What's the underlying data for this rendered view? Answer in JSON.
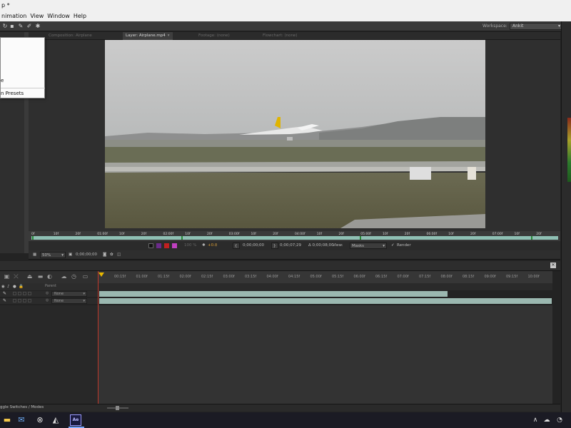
{
  "window": {
    "title_fragment": "p *"
  },
  "menu": [
    "nimation",
    "View",
    "Window",
    "Help"
  ],
  "workspace": {
    "label": "Workspace:",
    "value": "Ankit"
  },
  "dropdown": {
    "item_e": "e",
    "item_presets": "n Presets"
  },
  "tabs": [
    {
      "label": "Composition: Airplane",
      "active": false
    },
    {
      "label": "Layer: Airplane.mp4",
      "active": true,
      "has_dropdown": true
    },
    {
      "label": "Footage: (none)",
      "active": false
    },
    {
      "label": "Flowchart: (none)",
      "active": false
    }
  ],
  "layer_ruler": {
    "labels": [
      "0f",
      "10f",
      "20f",
      "01:00f",
      "10f",
      "20f",
      "02:00f",
      "10f",
      "20f",
      "03:00f",
      "10f",
      "20f",
      "04:00f",
      "10f",
      "20f",
      "05:00f",
      "10f",
      "20f",
      "06:00f",
      "10f",
      "20f",
      "07:00f",
      "10f",
      "20f"
    ]
  },
  "viewer_controls": {
    "timecode_in": "0;00;00;00",
    "timecode_out": "0;00;07;29",
    "duration": "Δ 0;00;08;00",
    "view_label": "View:",
    "view_value": "Masks",
    "render_label": "Render",
    "exposure": "+0.0",
    "zoom_text": "100 %"
  },
  "viewer_status": {
    "magnification": "50%",
    "timecode": "0;00;00;00"
  },
  "timeline": {
    "time_labels": [
      "00:15f",
      "01:00f",
      "01:15f",
      "02:00f",
      "02:15f",
      "03:00f",
      "03:15f",
      "04:00f",
      "04:15f",
      "05:00f",
      "05:15f",
      "06:00f",
      "06:15f",
      "07:00f",
      "07:15f",
      "08:00f",
      "08:15f",
      "09:00f",
      "09:15f",
      "10:00f"
    ],
    "parent_header": "Parent",
    "layers": [
      {
        "parent": "None",
        "bar_fraction": 0.77
      },
      {
        "parent": "None",
        "bar_fraction": 1.0
      }
    ],
    "toggle_label": "ggle Switches / Modes"
  },
  "colors": {
    "ruler_bar": "#8fc0b4",
    "layer_bar": "#9bb8b0",
    "playhead": "#c0392b",
    "playhead_head": "#e8b800"
  },
  "taskbar_icons": [
    "file-explorer-icon",
    "mail-icon",
    "xbox-icon",
    "vr-icon",
    "after-effects-icon"
  ],
  "tray_icons": [
    "chevron-up-icon",
    "cloud-icon",
    "wifi-icon"
  ]
}
